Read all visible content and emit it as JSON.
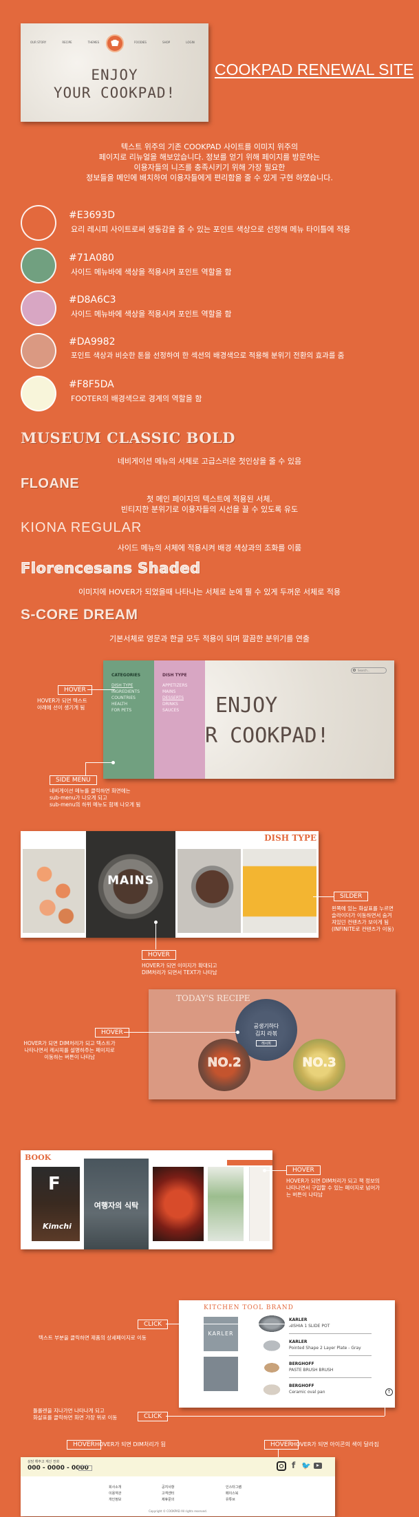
{
  "hero": {
    "nav_left": [
      "OUR STORY",
      "RECIPE",
      "THEMES"
    ],
    "nav_right": [
      "FOODIES",
      "SHOP",
      "LOGIN"
    ],
    "headline_1": "ENJOY",
    "headline_2": "YOUR COOKPAD!",
    "site_title": "COOKPAD RENEWAL SITE"
  },
  "intro": {
    "line1": "텍스트 위주의 기존 COOKPAD 사이트를 이미지 위주의",
    "line2": "페이지로 리뉴얼을 해보았습니다. 정보를 얻기 위해 페이지를 방문하는",
    "line3": "이용자들의 니즈를 충족시키기 위해 가장 필요한",
    "line4": "정보들을 메인에 배치하여 이용자들에게 편리함을 줄 수 있게 구현 하였습니다."
  },
  "palette": [
    {
      "hex": "#E3693D",
      "desc": "요리 레시피 사이트로써 생동감을 줄 수 있는 포인트 색상으로 선정해 메뉴 타이틀에 적용"
    },
    {
      "hex": "#71A080",
      "desc": "사이드 메뉴바에 색상을 적용시켜 포인트 역할을 함"
    },
    {
      "hex": "#D8A6C3",
      "desc": "사이드 메뉴바에 색상을 적용시켜 포인트 역할을 함"
    },
    {
      "hex": "#DA9982",
      "desc": "포인트 색상과 비슷한 톤을 선정하여 한 섹션의 배경색으로 적용해 분위기 전환의 효과를 줌"
    },
    {
      "hex": "#F8F5DA",
      "desc": "FOOTER의 배경색으로 경계의 역할을 함"
    }
  ],
  "fonts": [
    {
      "name": "MUSEUM CLASSIC BOLD",
      "desc": "네비게이션 메뉴의 서체로 고급스러운 첫인상을 줄 수 있음"
    },
    {
      "name": "FLOANE",
      "desc1": "첫 메인 페이지의 텍스트에 적용된 서체.",
      "desc2": "빈티지한 분위기로 이용자들의 시선을 끌 수 있도록 유도"
    },
    {
      "name": "KIONA REGULAR",
      "desc": "사이드 메뉴의 서체에 적용시켜 배경 색상과의 조화를 이룸"
    },
    {
      "name": "Florencesans Shaded",
      "desc": "이미지에 HOVER가 되었을때 나타나는 서체로 눈에 띌 수 있게 두꺼운 서체로 적용"
    },
    {
      "name": "S-CORE DREAM",
      "desc": "기본서체로 영문과 한글 모두 적용이 되며 깔끔한 분위기를 연출"
    }
  ],
  "side_menu": {
    "categories_title": "CATEGORIES",
    "categories": [
      "DISH TYPE",
      "INGREDIENTS",
      "COUNTRIES",
      "HEALTH",
      "FOR PETS"
    ],
    "dish_title": "DISH TYPE",
    "dishes": [
      "APPETIZERS",
      "MAINS",
      "DESSERTS",
      "DRINKS",
      "SAUCES"
    ],
    "search_placeholder": "Search...",
    "bg_text_1": "ENJOY",
    "bg_text_2": "R COOKPAD!",
    "hover_tag": "HOVER",
    "hover_note_1": "HOVER가 되면 텍스트",
    "hover_note_2": "아래에 선이 생기게 됨",
    "side_tag": "SIDE MENU",
    "side_note_1": "네비게이션 메뉴를 클릭하면 화면에는",
    "side_note_2": "sub-menu가 나오게 되고",
    "side_note_3": "sub-menu의 하위 메뉴도 함께 나오게 됨"
  },
  "dish_type": {
    "title": "DISH TYPE",
    "hover_label": "MAINS",
    "slider_tag": "SILDER",
    "slider_note_1": "왼쪽에 있는 화살표를 누르면",
    "slider_note_2": "슬라이더가 이동하면서 숨겨",
    "slider_note_3": "져있던 컨텐츠가 보이게 됨",
    "slider_note_4": "(INFINITE로 컨텐츠가 이동)",
    "hover_tag": "HOVER",
    "hover_note_1": "HOVER가 되면 이미지가 확대되고",
    "hover_note_2": "DIM처리가 되면서 TEXT가 나타남"
  },
  "todays_recipe": {
    "title": "TODAY'S RECIPE",
    "center_line1": "공생기하다",
    "center_line2": "김치 라볶",
    "center_button": "레시피",
    "no2": "NO.2",
    "no3": "NO.3",
    "hover_tag": "HOVER",
    "hover_note_1": "HOVER가 되면 DIM처리가 되고 텍스트가",
    "hover_note_2": "나타나면서 레시피를 설명하주는 페이지로",
    "hover_note_3": "이동하는 버튼이 나타남"
  },
  "book": {
    "title": "BOOK",
    "kimchi": "Kimchi",
    "f_letter": "F",
    "traveler": "여행자의 식탁",
    "hover_tag": "HOVER",
    "hover_note_1": "HOVER가 되면 DIM처리가 되고 책 정보의",
    "hover_note_2": "나타나면서 구입할 수 있는 페이지로 넘어가",
    "hover_note_3": "는 버튼이 나타남"
  },
  "kitchen": {
    "title": "KITCHEN TOOL BRAND",
    "brand1": "KARLER",
    "items": [
      {
        "name": "KARLER",
        "sub": "NISHIA 1 SLIDE POT"
      },
      {
        "name": "KARLER",
        "sub": "Pointed Shape 2 Layer Plate - Gray"
      },
      {
        "name": "BERGHOFF",
        "sub": "PASTE BRUSH BRUSH"
      },
      {
        "name": "BERGHOFF",
        "sub": "Ceramic oval pan"
      }
    ],
    "click_tag_1": "CLICK",
    "click_note_1": "텍스트 부분을 클릭하면 제품의 상세페이지로 이동",
    "click_tag_2": "CLICK",
    "click_note_2a": "틀롤렌을 지나가면 나타나게 되고",
    "click_note_2b": "화살표를 클릭하면 화면 가장 위로 이동"
  },
  "footer": {
    "hover_tag_1": "HOVER",
    "hover_note_1": "HOVER가 되면 DIM처리가 됨",
    "hover_tag_2": "HOVER",
    "hover_note_2": "HOVER가 되면 아이콘의 색이 달라짐",
    "cs_label": "상담 해주고 계신 전화",
    "phone": "000 - 0000 - 0000",
    "col1": [
      "회사소개",
      "이용약관",
      "개인정보"
    ],
    "col2": [
      "공지사항",
      "고객센터",
      "제휴문의"
    ],
    "col3": [
      "인스타그램",
      "페이스북",
      "유튜브"
    ],
    "copyright": "Copyright © COOKPAD All rights reserved."
  },
  "colors": {
    "orange": "#E3693D",
    "green": "#71A080",
    "pink": "#D8A6C3",
    "salmon": "#DA9982",
    "cream": "#F8F5DA"
  }
}
